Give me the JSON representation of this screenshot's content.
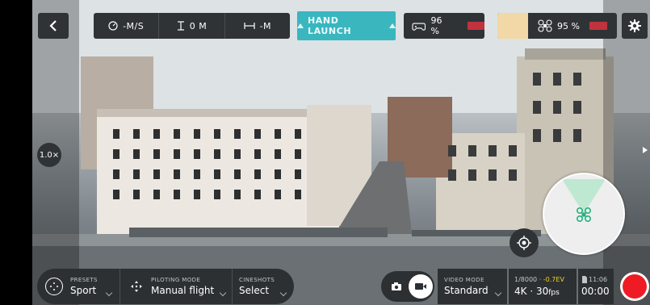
{
  "top_bar": {
    "back_icon": "chevron-left-icon",
    "speed": "-M/S",
    "altitude": "0 M",
    "distance": "-M",
    "hand_launch_label": "HAND LAUNCH",
    "controller_battery": "96 %",
    "drone_battery": "95 %",
    "settings_icon": "gear-icon",
    "warning_color": "#f2d8a6",
    "accent_color": "#3ab6bf",
    "alert_color": "#d9343f"
  },
  "zoom_label": "1.0×",
  "presets": {
    "caption": "PRESETS",
    "value": "Sport"
  },
  "piloting_mode": {
    "caption": "PILOTING MODE",
    "value": "Manual flight"
  },
  "cineshots": {
    "caption": "CINESHOTS",
    "value": "Select"
  },
  "video_mode": {
    "caption": "VIDEO MODE",
    "value": "Standard"
  },
  "exposure": {
    "shutter": "1/8000 · ",
    "ev": "-0.7EV",
    "resolution": "4K · 30",
    "fps_unit": "fps"
  },
  "storage": {
    "remaining": "11:06",
    "recording_time": "00:00"
  },
  "record_color": "#ef1b24"
}
